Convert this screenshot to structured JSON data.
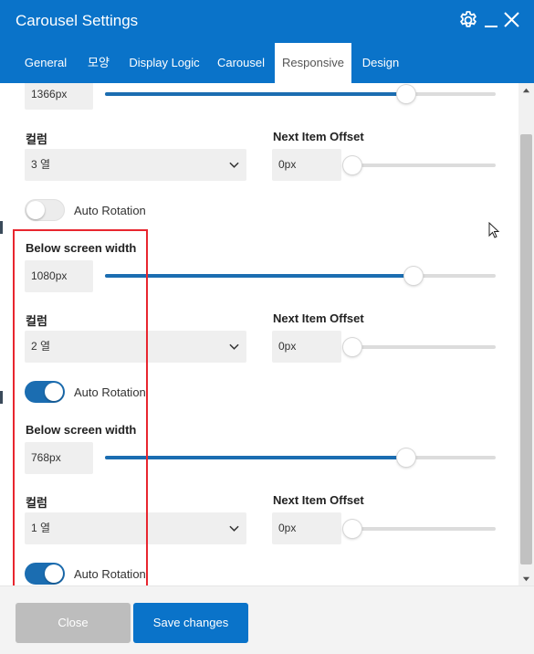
{
  "window": {
    "title": "Carousel Settings",
    "settings_icon": "gear-icon",
    "minimize_icon": "minimize-icon",
    "close_icon": "close-icon"
  },
  "tabs": [
    {
      "label": "General",
      "active": false
    },
    {
      "label": "모양",
      "active": false
    },
    {
      "label": "Display Logic",
      "active": false
    },
    {
      "label": "Carousel",
      "active": false
    },
    {
      "label": "Responsive",
      "active": true
    },
    {
      "label": "Design",
      "active": false
    }
  ],
  "top_partial": {
    "width_value": "1366px",
    "slider_fraction": 0.77
  },
  "block1": {
    "columns_label": "컬럼",
    "columns_value": "3 열",
    "offset_label": "Next Item Offset",
    "offset_value": "0px",
    "offset_fraction": 0.0,
    "auto_rotation_label": "Auto Rotation",
    "auto_rotation_on": false
  },
  "block2": {
    "width_label": "Below screen width",
    "width_value": "1080px",
    "slider_fraction": 0.79,
    "columns_label": "컬럼",
    "columns_value": "2 열",
    "offset_label": "Next Item Offset",
    "offset_value": "0px",
    "offset_fraction": 0.0,
    "auto_rotation_label": "Auto Rotation",
    "auto_rotation_on": true
  },
  "block3": {
    "width_label": "Below screen width",
    "width_value": "768px",
    "slider_fraction": 0.77,
    "columns_label": "컬럼",
    "columns_value": "1 열",
    "offset_label": "Next Item Offset",
    "offset_value": "0px",
    "offset_fraction": 0.0,
    "auto_rotation_label": "Auto Rotation",
    "auto_rotation_on": true
  },
  "footer": {
    "close_label": "Close",
    "save_label": "Save changes"
  },
  "colors": {
    "brand": "#0a73c9",
    "slider_fill": "#1b6db1",
    "highlight": "#e8262f"
  }
}
